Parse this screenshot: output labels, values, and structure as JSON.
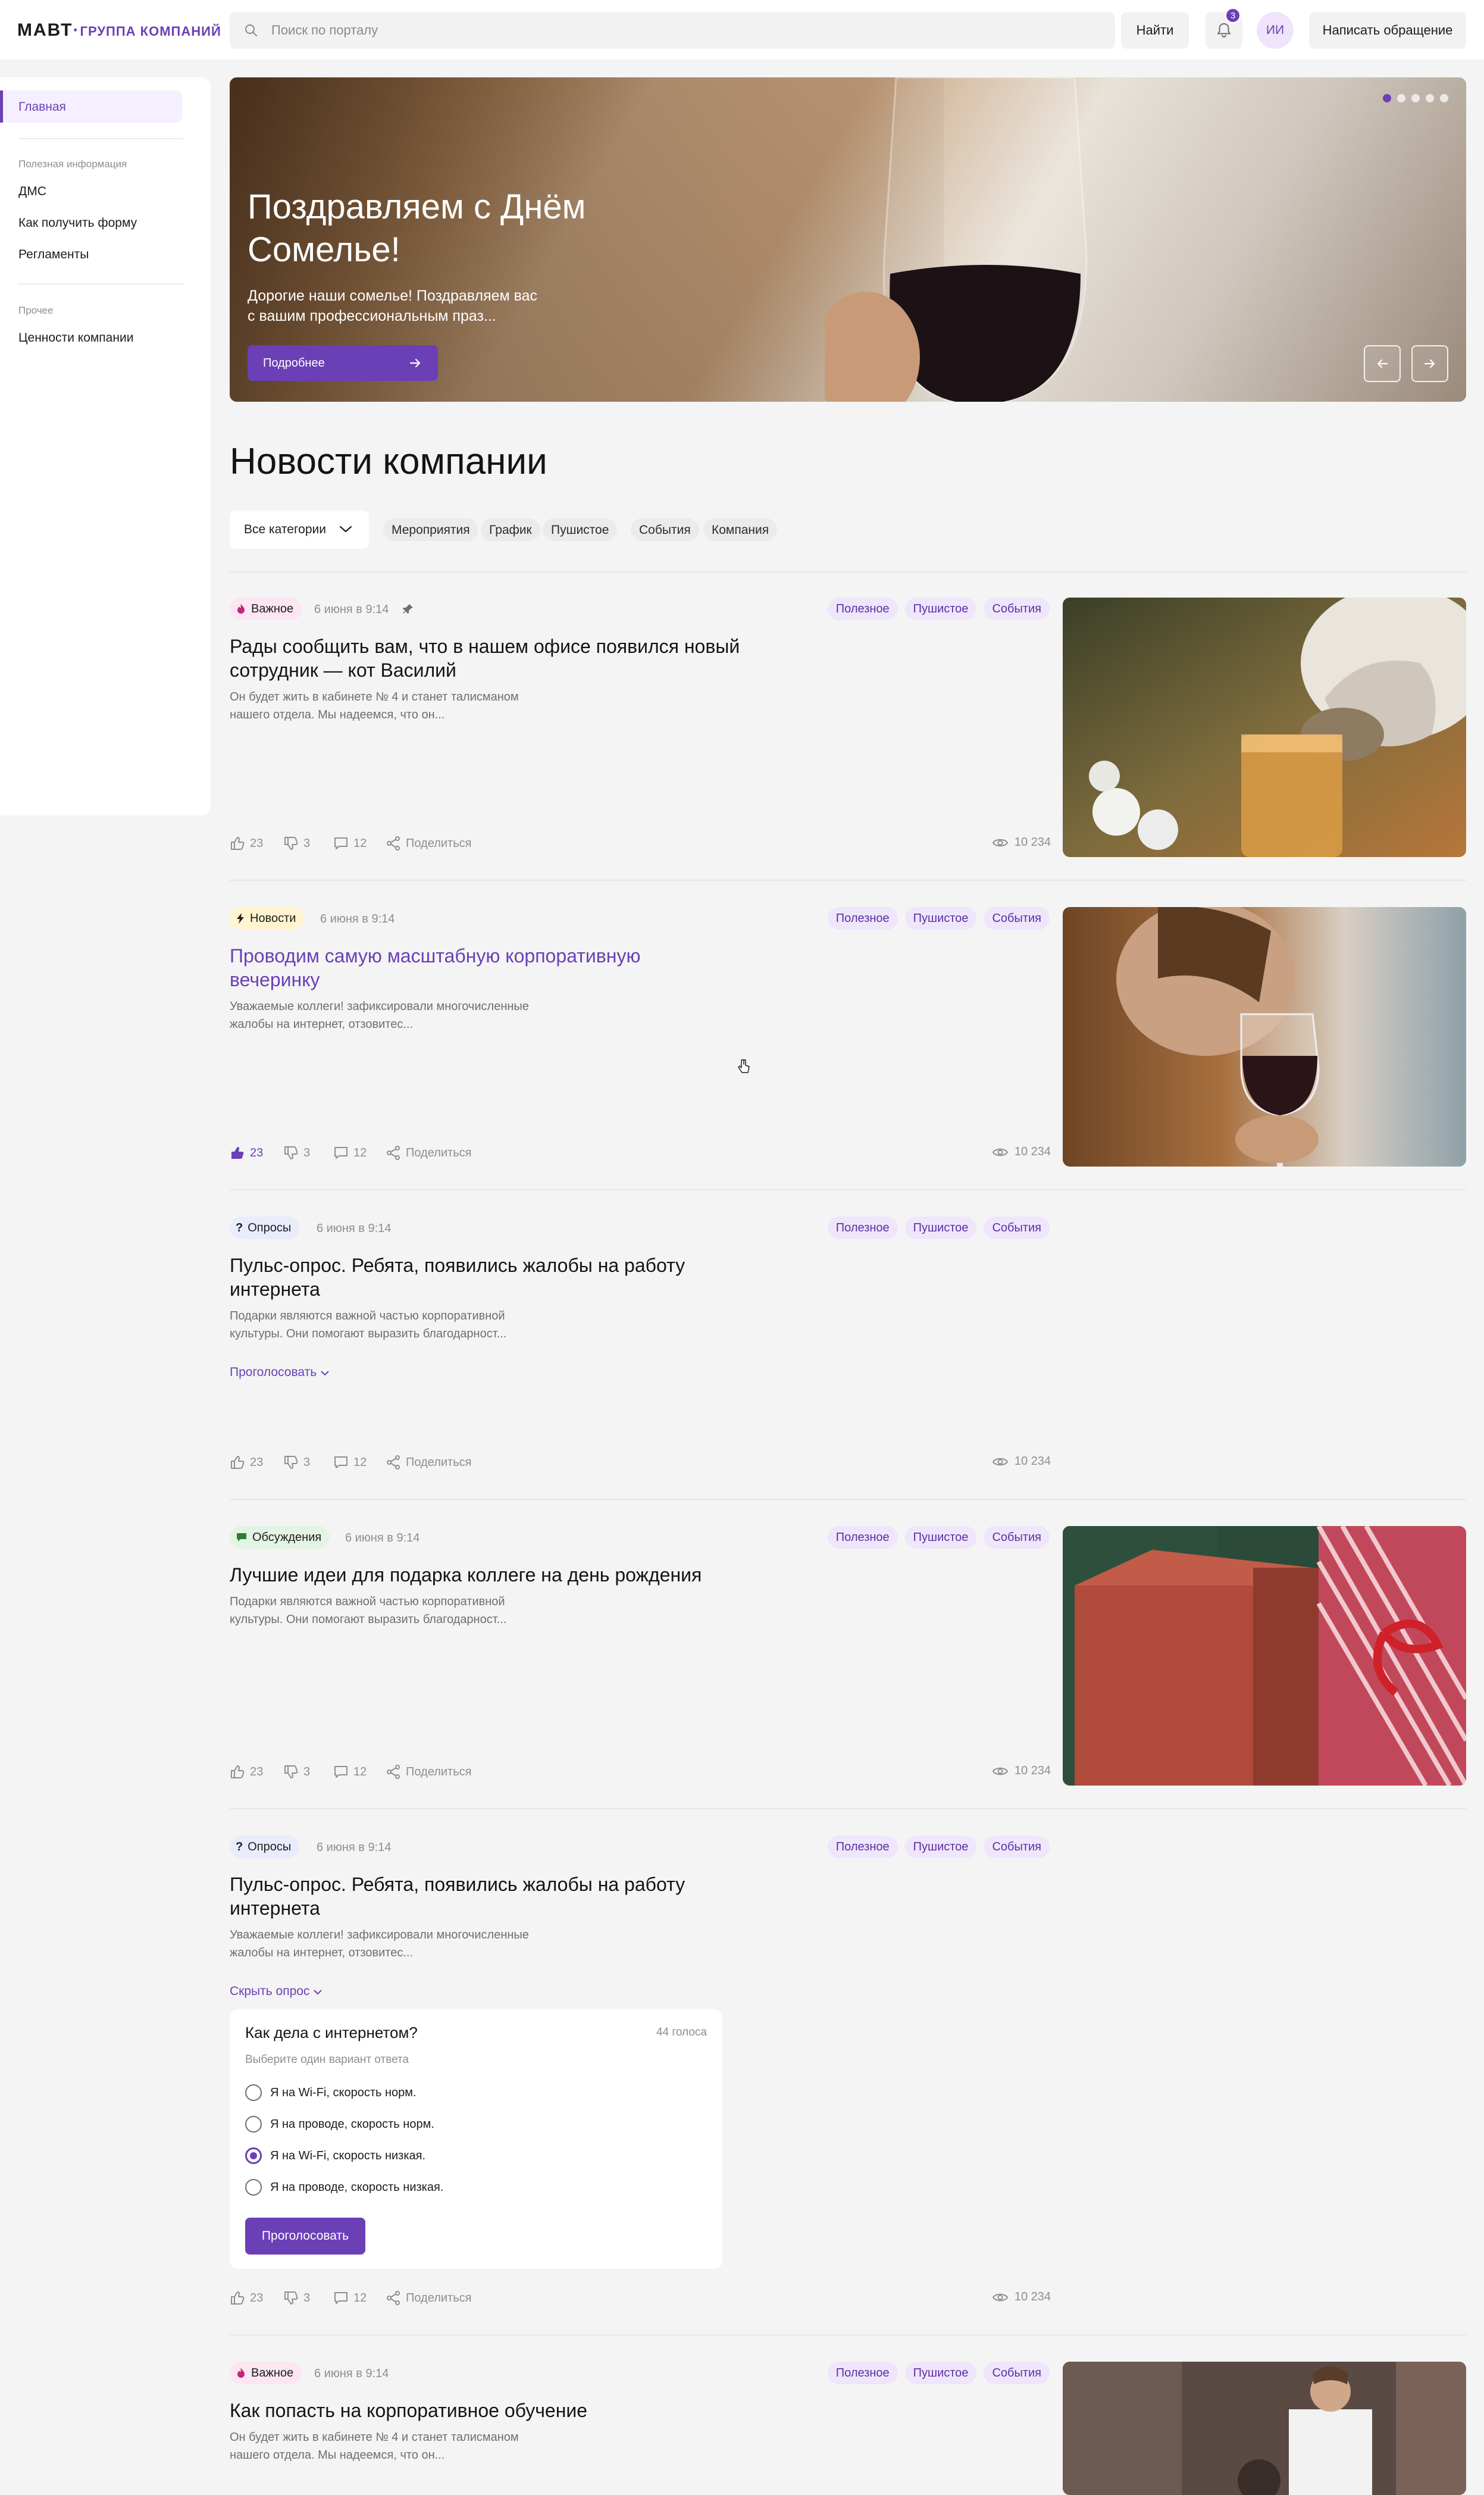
{
  "header": {
    "logo_main": "МАВТ",
    "logo_dot": "·",
    "logo_sub": "ГРУППА КОМПАНИЙ",
    "search_placeholder": "Поиск по порталу",
    "find_label": "Найти",
    "notifications_count": "3",
    "avatar_initials": "ИИ",
    "appeal_label": "Написать обращение"
  },
  "sidebar": {
    "home": "Главная",
    "section1": "Полезная информация",
    "items1": [
      "ДМС",
      "Как получить форму",
      "Регламенты"
    ],
    "section2": "Прочее",
    "items2": [
      "Ценности компании"
    ]
  },
  "banner": {
    "title": "Поздравляем с Днём Сомелье!",
    "text": "Дорогие наши сомелье! Поздравляем вас с вашим профессиональным праз...",
    "button": "Подробнее",
    "slides_total": 5,
    "slide_active": 1
  },
  "news": {
    "title": "Новости компании",
    "all_categories": "Все категории",
    "filters": [
      "Мероприятия",
      "График",
      "Пушистое",
      "События",
      "Компания"
    ]
  },
  "posts": [
    {
      "tag": "Важное",
      "date": "6 июня в 9:14",
      "cats": [
        "Полезное",
        "Пушистое",
        "События"
      ],
      "title": "Рады сообщить вам, что в нашем офисе появился новый сотрудник — кот Василий",
      "text": "Он будет жить в кабинете № 4 и станет талисманом нашего отдела. Мы надеемся, что он...",
      "likes": "23",
      "dislikes": "3",
      "comments": "12",
      "share": "Поделиться",
      "views": "10 234"
    },
    {
      "tag": "Новости",
      "date": "6 июня в 9:14",
      "cats": [
        "Полезное",
        "Пушистое",
        "События"
      ],
      "title": "Проводим самую масштабную корпоративную вечеринку",
      "text": "Уважаемые коллеги! зафиксировали многочисленные жалобы на интернет, отзовитес...",
      "likes": "23",
      "dislikes": "3",
      "comments": "12",
      "share": "Поделиться",
      "views": "10 234"
    },
    {
      "tag": "Опросы",
      "date": "6 июня в 9:14",
      "cats": [
        "Полезное",
        "Пушистое",
        "События"
      ],
      "title": "Пульс-опрос. Ребята, появились жалобы на работу интернета",
      "text": "Подарки являются важной частью корпоративной культуры. Они помогают выразить благодарност...",
      "vote_link": "Проголосовать",
      "likes": "23",
      "dislikes": "3",
      "comments": "12",
      "share": "Поделиться",
      "views": "10 234"
    },
    {
      "tag": "Обсуждения",
      "date": "6 июня в 9:14",
      "cats": [
        "Полезное",
        "Пушистое",
        "События"
      ],
      "title": "Лучшие идеи для подарка коллеге на день рождения",
      "text": "Подарки являются важной частью корпоративной культуры. Они помогают выразить благодарност...",
      "likes": "23",
      "dislikes": "3",
      "comments": "12",
      "share": "Поделиться",
      "views": "10 234"
    },
    {
      "tag": "Опросы",
      "date": "6 июня в 9:14",
      "cats": [
        "Полезное",
        "Пушистое",
        "События"
      ],
      "title": "Пульс-опрос. Ребята, появились жалобы на работу интернета",
      "text": "Уважаемые коллеги! зафиксировали многочисленные жалобы на интернет, отзовитес...",
      "hide_link": "Скрыть опрос",
      "poll": {
        "question": "Как дела с интернетом?",
        "count": "44 голоса",
        "hint": "Выберите один вариант ответа",
        "options": [
          "Я на Wi-Fi, скорость норм.",
          "Я на проводе, скорость норм.",
          "Я на Wi-Fi, скорость низкая.",
          "Я на проводе, скорость низкая."
        ],
        "selected_index": 2,
        "button": "Проголосовать"
      },
      "likes": "23",
      "dislikes": "3",
      "comments": "12",
      "share": "Поделиться",
      "views": "10 234"
    },
    {
      "tag": "Важное",
      "date": "6 июня в 9:14",
      "cats": [
        "Полезное",
        "Пушистое",
        "События"
      ],
      "title": "Как попасть на корпоративное обучение",
      "text": "Он будет жить в кабинете № 4 и станет талисманом нашего отдела. Мы надеемся, что он..."
    }
  ],
  "colors": {
    "accent": "#6b3fb6",
    "background": "#f4f4f4",
    "important_tag": "#fce6f1",
    "news_tag": "#fff4cf",
    "poll_tag": "#e8ecfb",
    "discussion_tag": "#e3f4e4"
  }
}
